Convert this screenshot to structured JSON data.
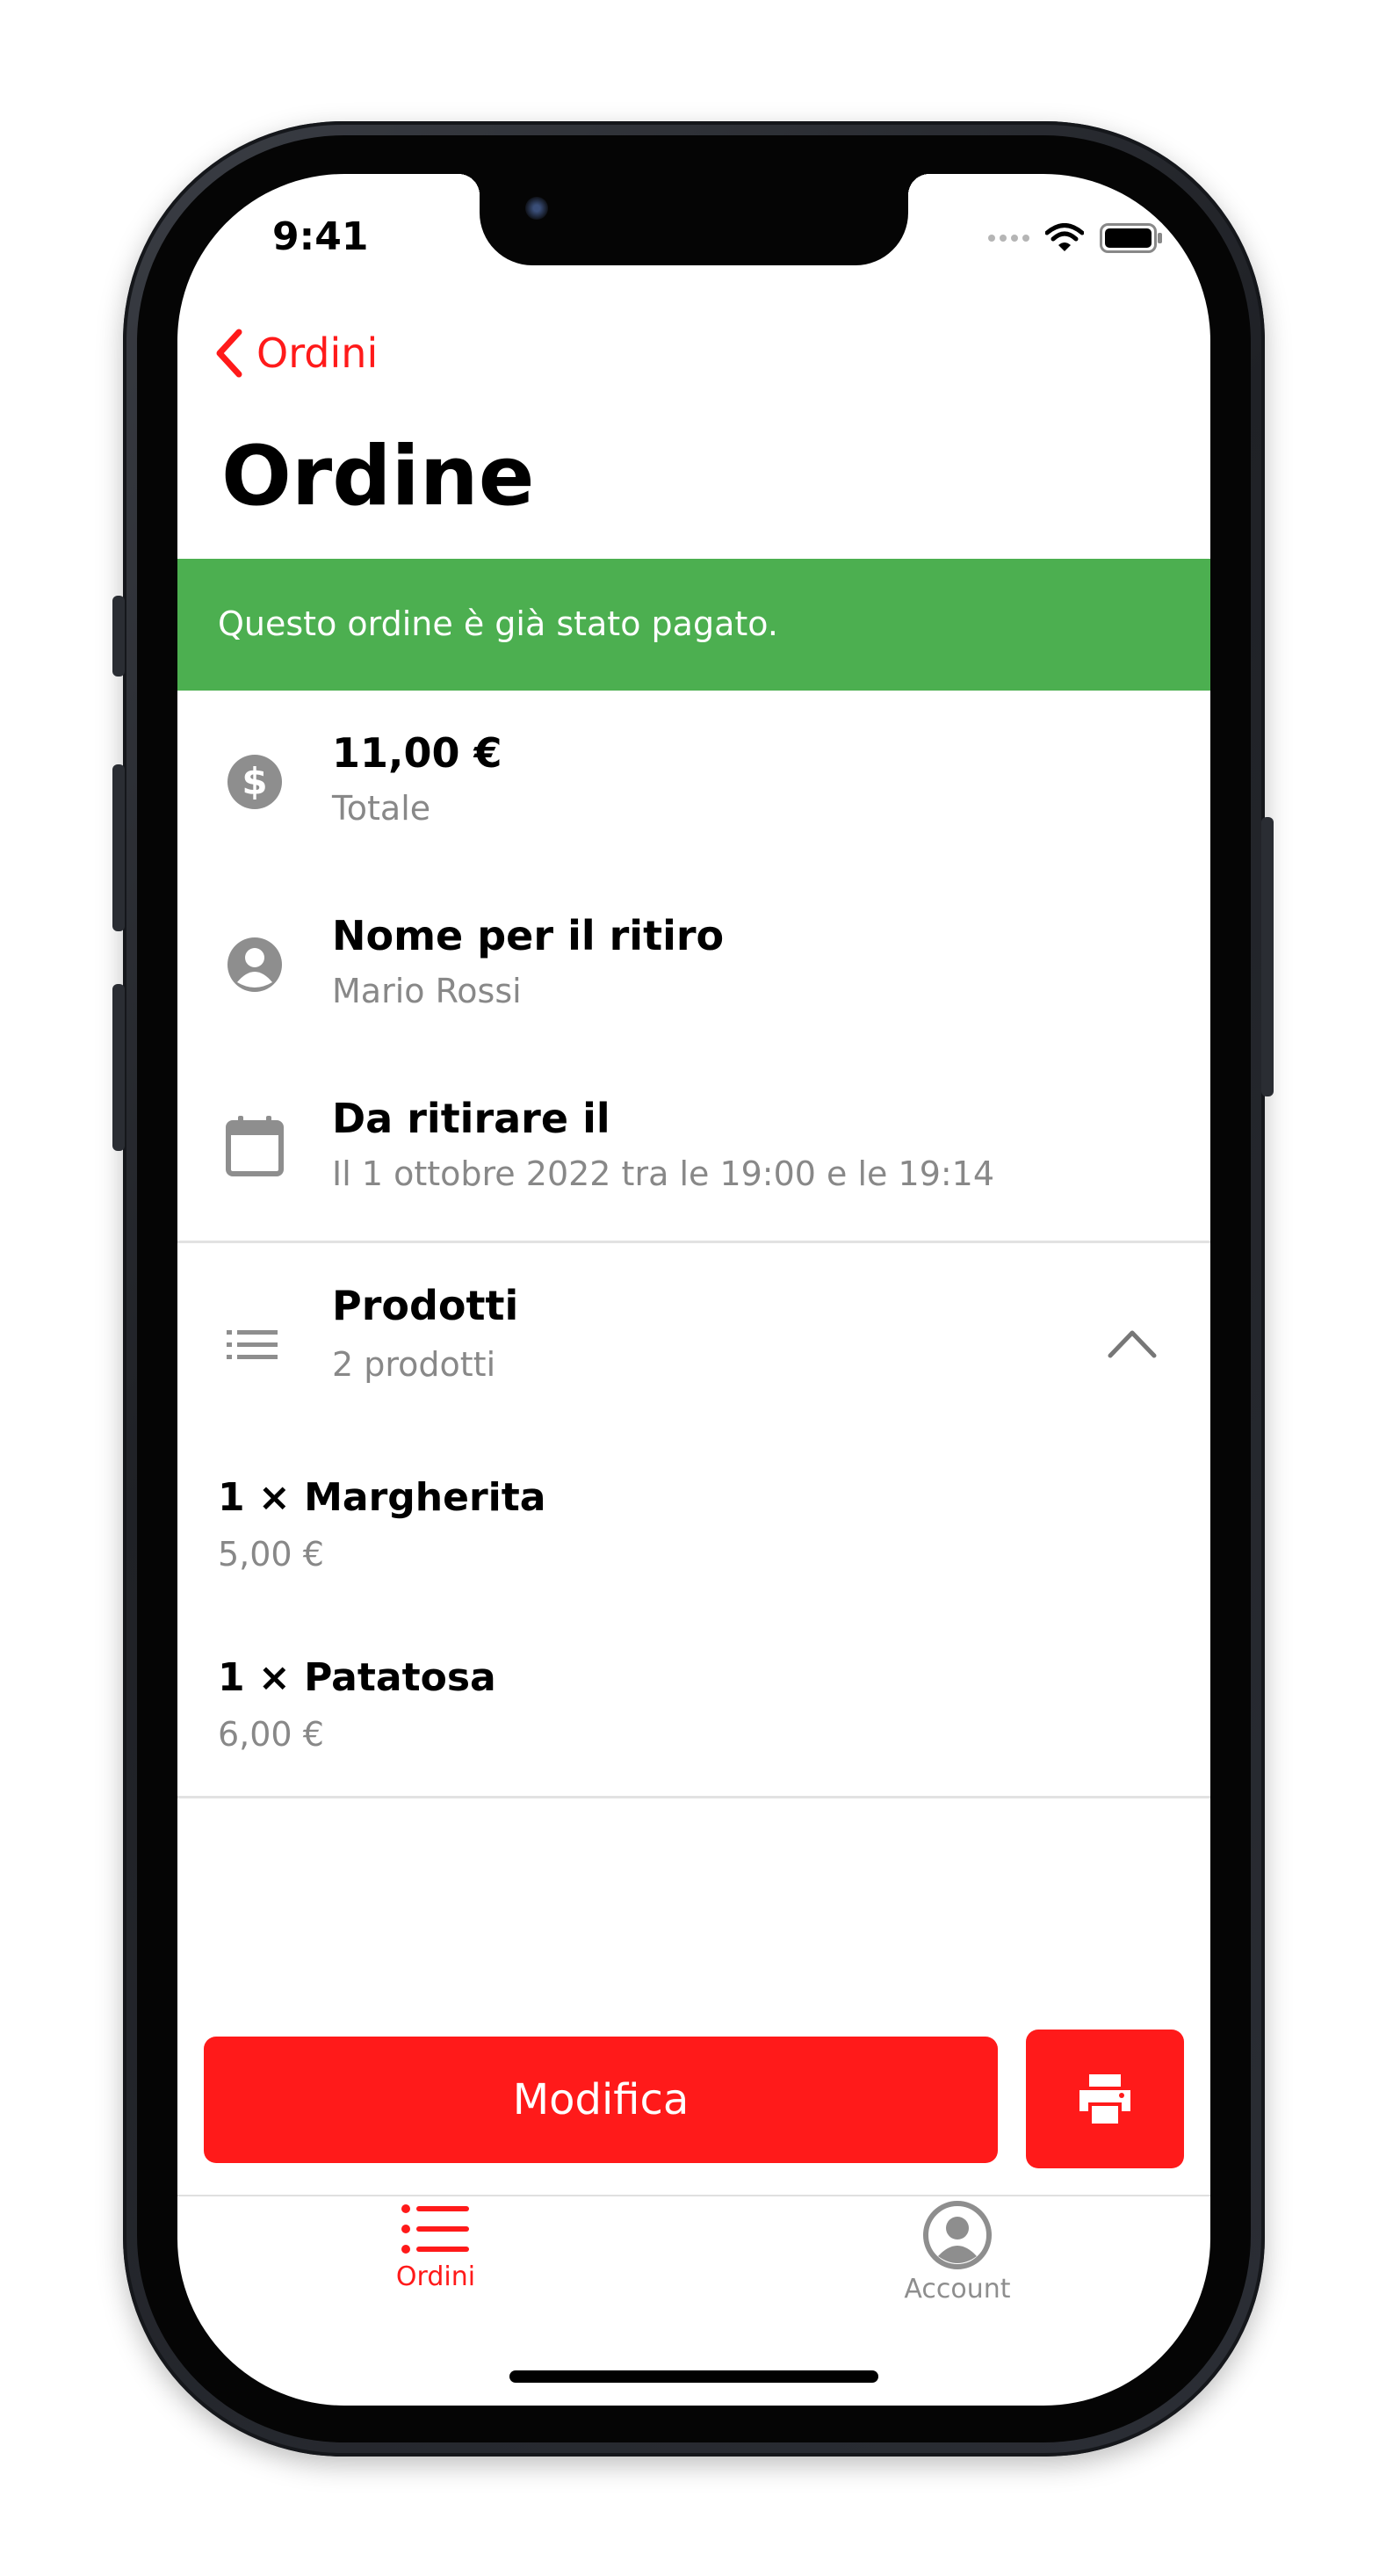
{
  "status_bar": {
    "time": "9:41"
  },
  "nav": {
    "back_label": "Ordini",
    "title": "Ordine"
  },
  "banner": {
    "text": "Questo ordine è già stato pagato.",
    "color": "#4caf50"
  },
  "details": [
    {
      "icon": "dollar-circle-icon",
      "title": "11,00 €",
      "subtitle": "Totale"
    },
    {
      "icon": "person-circle-icon",
      "title": "Nome per il ritiro",
      "subtitle": "Mario Rossi"
    },
    {
      "icon": "calendar-icon",
      "title": "Da ritirare il",
      "subtitle": "Il 1 ottobre 2022 tra le 19:00 e le 19:14"
    }
  ],
  "products": {
    "title": "Prodotti",
    "subtitle": "2 prodotti",
    "expanded": true,
    "items": [
      {
        "name": "1 × Margherita",
        "price": "5,00 €"
      },
      {
        "name": "1 × Patatosa",
        "price": "6,00 €"
      }
    ]
  },
  "actions": {
    "edit_label": "Modifica",
    "print_icon": "printer-icon",
    "accent": "#ff1a1a"
  },
  "tabbar": {
    "tabs": [
      {
        "label": "Ordini",
        "icon": "list-icon",
        "active": true
      },
      {
        "label": "Account",
        "icon": "account-circle-icon",
        "active": false
      }
    ]
  }
}
